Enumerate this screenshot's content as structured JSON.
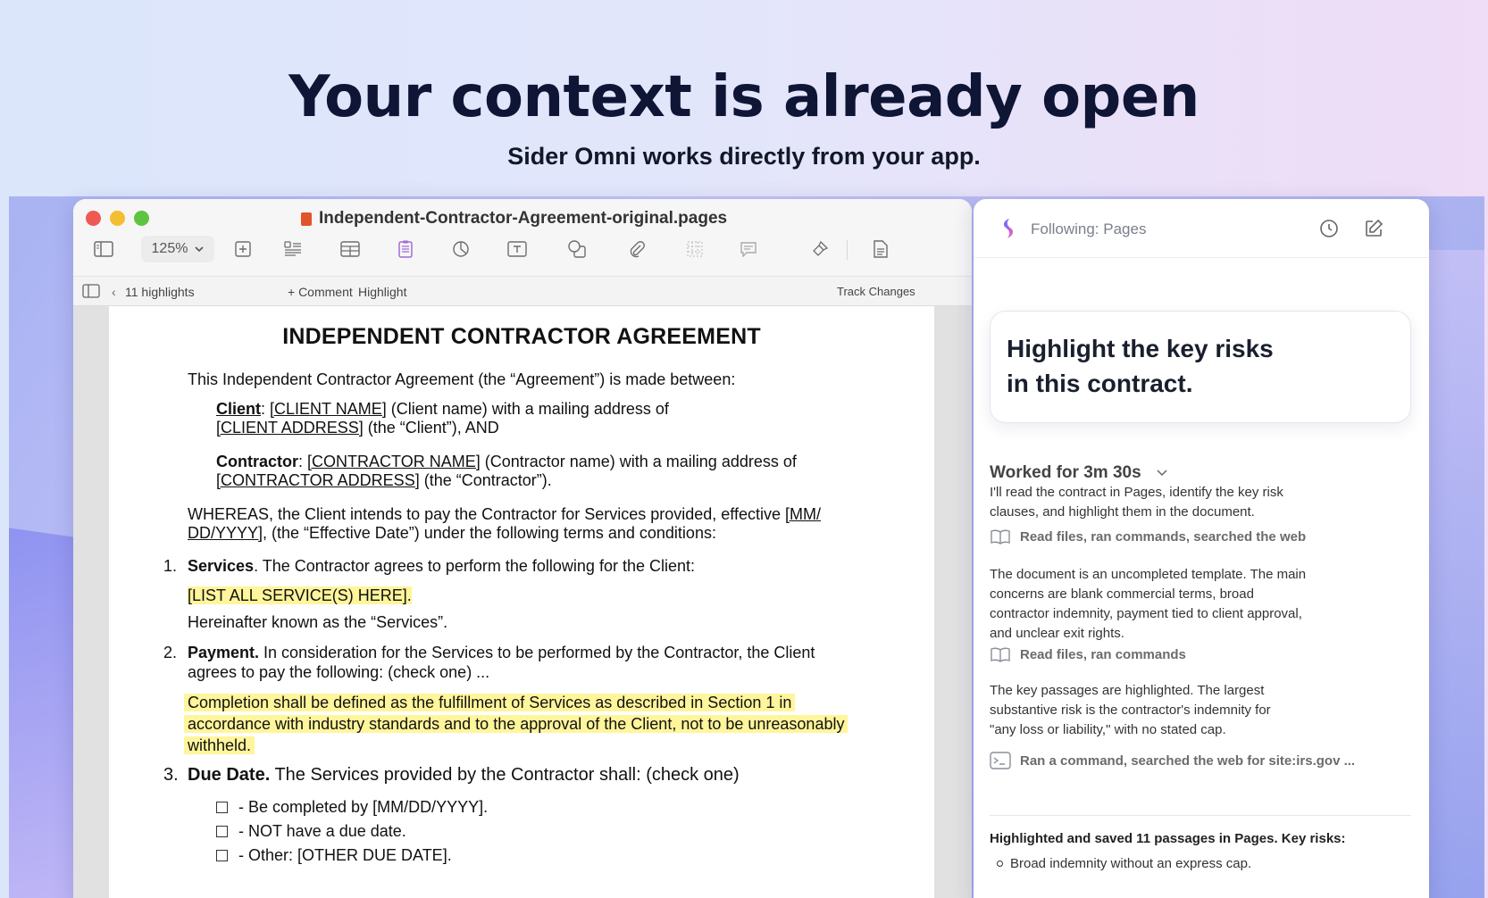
{
  "hero": {
    "title": "Your context is already open",
    "subtitle": "Sider Omni works directly from your app."
  },
  "window": {
    "doc_title": "Independent-Contractor-Agreement-original.pages",
    "zoom": "125%",
    "highlights_count": "11 highlights",
    "comment_label": "+ Comment",
    "highlight_label": "Highlight",
    "track_changes_label": "Track Changes",
    "toolbar_icons": [
      "sidebar-icon",
      "add-page-icon",
      "paragraph-style-icon",
      "table-icon",
      "document-icon",
      "chart-icon",
      "text-box-icon",
      "shape-icon",
      "attachment-icon",
      "grid-icon",
      "comment-icon",
      "format-icon",
      "document-setup-icon"
    ]
  },
  "document": {
    "heading": "INDEPENDENT CONTRACTOR AGREEMENT",
    "intro": "This Independent Contractor Agreement (the “Agreement”) is made between:",
    "client_label": "Client",
    "client_name": "[CLIENT NAME]",
    "client_rest1": " (Client name) with a mailing address of",
    "client_address": "[CLIENT ADDRESS]",
    "client_rest2": " (the “Client”), AND",
    "contractor_label": "Contractor",
    "contractor_name": "[CONTRACTOR NAME]",
    "contractor_rest1": " (Contractor name) with a mailing address of",
    "contractor_address": "[CONTRACTOR ADDRESS]",
    "contractor_rest2": " (the “Contractor”).",
    "whereas_line1": "WHEREAS, the Client intends to pay the Contractor for Services provided, effective ",
    "whereas_date1": "[MM/",
    "whereas_date2": "DD/YYYY]",
    "whereas_line2": ", (the “Effective Date”) under the following terms and conditions:",
    "s1_num": "1.",
    "s1_title": "Services",
    "s1_text": ". The Contractor agrees to perform the following for the Client:",
    "s1_highlight": "[LIST ALL SERVICE(S) HERE].",
    "s1_after": "Hereinafter known as the “Services”.",
    "s2_num": "2.",
    "s2_title": "Payment.",
    "s2_text1": " In consideration for the Services to be performed by the Contractor, the Client",
    "s2_text2": "agrees to pay the following: (check one)  ...",
    "s2_hl1": "Completion shall be defined as the fulfillment of Services as described in Section 1 in",
    "s2_hl2": "accordance with industry standards and to the approval of the Client, not to be unreasonably",
    "s2_hl3": "withheld.",
    "s3_num": "3.",
    "s3_title": "Due Date.",
    "s3_text": " The Services provided by the Contractor shall: (check one)",
    "s3_opt1": "- Be completed by [MM/DD/YYYY].",
    "s3_opt2": "- NOT have a due date.",
    "s3_opt3": "- Other: [OTHER DUE DATE]."
  },
  "panel": {
    "following": "Following: Pages",
    "prompt": "Highlight the key risks in this contract.",
    "worked": "Worked for 3m 30s",
    "para1_l1": "I'll read the contract in Pages, identify the key risk",
    "para1_l2": "clauses, and highlight them in the document.",
    "step1": "Read files, ran commands, searched the web",
    "para2_l1": "The document is an uncompleted template. The main",
    "para2_l2": "concerns are blank commercial terms, broad",
    "para2_l3": "contractor indemnity, payment tied to client approval,",
    "para2_l4": "and unclear exit rights.",
    "step2": "Read files, ran commands",
    "para3_l1": "The key passages are highlighted. The largest",
    "para3_l2": "substantive risk is the contractor's indemnity for",
    "para3_l3": "\"any loss or liability,\" with no stated cap.",
    "step3": "Ran a command, searched the web for site:irs.gov ...",
    "summary": "Highlighted and saved 11 passages in Pages. Key risks:",
    "bullet1": "Broad indemnity without an express cap."
  }
}
